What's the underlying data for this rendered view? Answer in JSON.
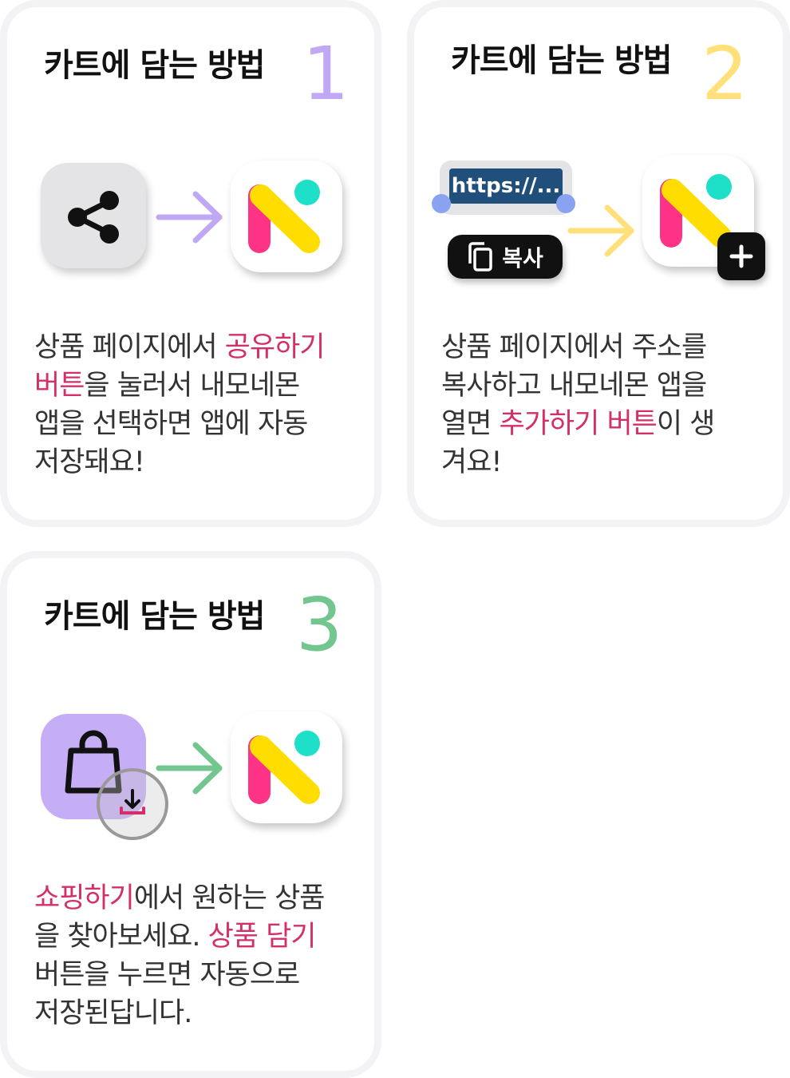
{
  "cards": [
    {
      "title": "카트에 담는 방법",
      "step": "1",
      "step_color": "#c0a8f4",
      "desc": [
        {
          "text": "상품 페이지에서 ",
          "hl": false
        },
        {
          "text": "공유하기",
          "hl": true
        },
        {
          "text": "\n",
          "hl": false
        },
        {
          "text": "버튼",
          "hl": true
        },
        {
          "text": "을 눌러서 내모네몬\n앱을 선택하면 앱에 자동\n저장돼요!",
          "hl": false
        }
      ]
    },
    {
      "title": "카트에 담는 방법",
      "step": "2",
      "step_color": "#ffe07a",
      "url_text": "https://...",
      "copy_label": "복사",
      "desc": [
        {
          "text": "상품 페이지에서 주소를\n복사하고 내모네몬 앱을\n열면 ",
          "hl": false
        },
        {
          "text": "추가하기 버튼",
          "hl": true
        },
        {
          "text": "이 생\n겨요!",
          "hl": false
        }
      ]
    },
    {
      "title": "카트에 담는 방법",
      "step": "3",
      "step_color": "#74c690",
      "desc": [
        {
          "text": "쇼핑하기",
          "hl": true
        },
        {
          "text": "에서 원하는 상품\n을 찾아보세요. ",
          "hl": false
        },
        {
          "text": "상품 담기",
          "hl": true
        },
        {
          "text": "\n버튼을 누르면 자동으로\n저장된답니다.",
          "hl": false
        }
      ]
    }
  ],
  "colors": {
    "highlight": "#d3306a",
    "logo_pink": "#ff3385",
    "logo_yellow": "#ffdd00",
    "logo_teal": "#1ee0c8",
    "arrow1": "#c0a8f4",
    "arrow2": "#ffe07a",
    "arrow3": "#74c690",
    "share_box": "#e4e4e6",
    "bag_box": "#c5aef6",
    "url_bg": "#1f4f7a",
    "handle": "#8aa3f0"
  },
  "icons": [
    "share-icon",
    "arrow-right-icon",
    "app-logo-icon",
    "copy-icon",
    "plus-icon",
    "shopping-bag-icon",
    "download-icon"
  ]
}
